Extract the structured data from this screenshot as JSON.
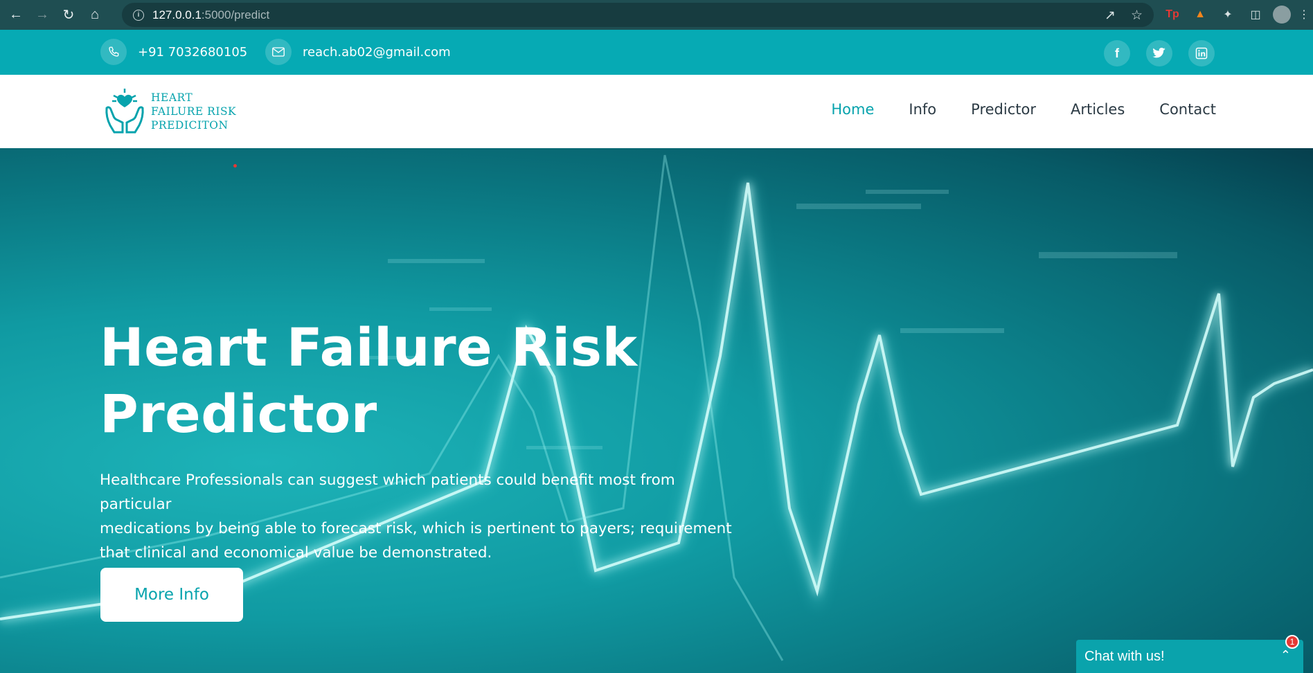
{
  "browser": {
    "url_host": "127.0.0.1",
    "url_path": ":5000/predict"
  },
  "topbar": {
    "phone": "+91 7032680105",
    "email": "reach.ab02@gmail.com"
  },
  "logo": {
    "line1": "HEART",
    "line2": "FAILURE RISK",
    "line3": "PREDICITON"
  },
  "nav": {
    "items": [
      {
        "label": "Home",
        "active": true
      },
      {
        "label": "Info",
        "active": false
      },
      {
        "label": "Predictor",
        "active": false
      },
      {
        "label": "Articles",
        "active": false
      },
      {
        "label": "Contact",
        "active": false
      }
    ]
  },
  "hero": {
    "title_line1": "Heart Failure Risk",
    "title_line2": "Predictor",
    "desc_line1": "Healthcare Professionals can suggest which patients could benefit most from particular",
    "desc_line2": "medications by being able to forecast risk, which is pertinent to payers; requirement",
    "desc_line3": "that clinical and economical value be demonstrated.",
    "button_label": "More Info"
  },
  "chat": {
    "label": "Chat with us!",
    "badge_count": "1"
  },
  "colors": {
    "accent": "#07a3ad",
    "topbar": "#06aab4",
    "badge": "#e53935"
  }
}
